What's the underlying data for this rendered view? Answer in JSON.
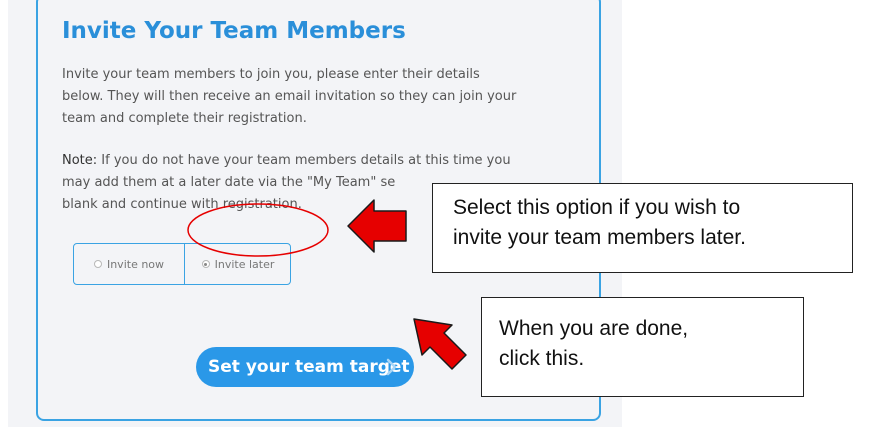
{
  "invite": {
    "title": "Invite Your Team Members",
    "description_lines": [
      "Invite your team members to join you, please enter their details",
      "below. They will then receive an email invitation so they can join your",
      "team and complete their registration."
    ],
    "note_label": "Note:",
    "note_lines": [
      " If you do not have your team members details at this time you",
      "may add them at a later date via the \"My Team\" se",
      "blank and continue with registration."
    ],
    "options": [
      {
        "label": "Invite now",
        "selected": false
      },
      {
        "label": "Invite later",
        "selected": true
      }
    ],
    "cta_label": "Set your team target"
  },
  "callouts": {
    "option_hint_lines": [
      "Select this option if you wish to",
      "invite your team members later."
    ],
    "done_hint_lines": [
      "When you are done,",
      "click this."
    ]
  },
  "colors": {
    "accent": "#2a98e8",
    "title": "#2a8fd9",
    "annotation": "#e60000",
    "panel_bg": "#f3f4f7"
  },
  "icons": {
    "cta_chevron": "chevron-right-icon",
    "arrow": "red-arrow-icon"
  }
}
